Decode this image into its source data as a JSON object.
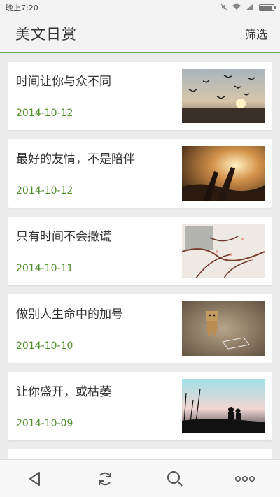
{
  "status_bar": {
    "time": "晚上7:20"
  },
  "app_bar": {
    "title": "美文日赏",
    "filter_label": "筛选"
  },
  "articles": [
    {
      "title": "时间让你与众不同",
      "date": "2014-10-12",
      "image": "birds-at-sunset"
    },
    {
      "title": "最好的友情，不是陪伴",
      "date": "2014-10-12",
      "image": "hands-at-sunset"
    },
    {
      "title": "只有时间不会撒谎",
      "date": "2014-10-11",
      "image": "branches-window"
    },
    {
      "title": "做别人生命中的加号",
      "date": "2014-10-10",
      "image": "cardboard-robot"
    },
    {
      "title": "让你盛开，或枯萎",
      "date": "2014-10-09",
      "image": "couple-silhouette"
    }
  ],
  "nav_bar": {
    "icons": [
      "back-icon",
      "refresh-icon",
      "search-icon",
      "more-icon"
    ]
  },
  "colors": {
    "accent": "#6aa84f",
    "date_text": "#4f8f2b"
  }
}
